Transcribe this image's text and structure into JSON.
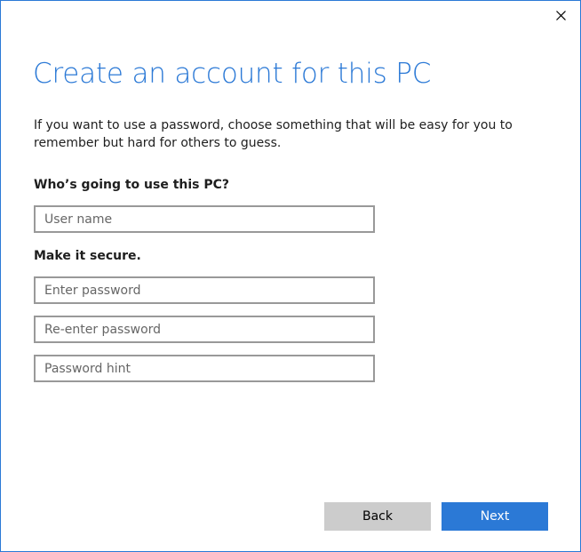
{
  "window": {
    "close_icon": "close-icon"
  },
  "page": {
    "title": "Create an account for this PC",
    "description": "If you want to use a password, choose something that will be easy for you to remember but hard for others to guess."
  },
  "user_section": {
    "label": "Who’s going to use this PC?",
    "username_placeholder": "User name",
    "username_value": ""
  },
  "security_section": {
    "label": "Make it secure.",
    "password_placeholder": "Enter password",
    "password_value": "",
    "reenter_placeholder": "Re-enter password",
    "reenter_value": "",
    "hint_placeholder": "Password hint",
    "hint_value": ""
  },
  "footer": {
    "back_label": "Back",
    "next_label": "Next"
  },
  "colors": {
    "accent": "#2b79d6",
    "secondary_button": "#cccccc",
    "field_border": "#999999"
  }
}
